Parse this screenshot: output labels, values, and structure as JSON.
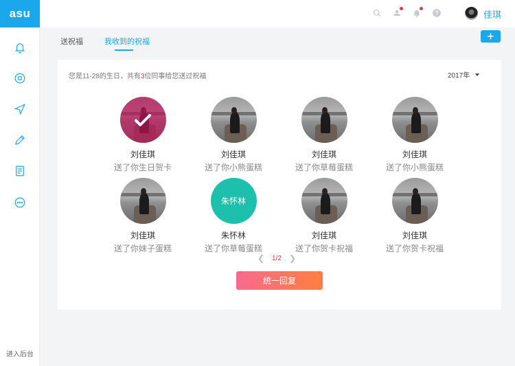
{
  "app": {
    "logo_text": "asu"
  },
  "sidebar": {
    "items": [
      {
        "icon": "bell-icon"
      },
      {
        "icon": "app-circle-icon"
      },
      {
        "icon": "send-icon"
      },
      {
        "icon": "edit-icon"
      },
      {
        "icon": "document-icon"
      },
      {
        "icon": "more-icon"
      }
    ],
    "enter_admin": "进入后台"
  },
  "topbar": {
    "icons": [
      "search-icon",
      "notification-icon",
      "bell-icon",
      "help-icon"
    ],
    "user_name": "佳琪"
  },
  "tabs": {
    "send": "送祝福",
    "received": "我收到的祝福",
    "plus": "+"
  },
  "summary": {
    "prefix": "您是11-28的生日，共有",
    "count": "3",
    "suffix": "位同事给您送过祝福"
  },
  "year": {
    "selected": "2017年"
  },
  "wishes": [
    {
      "name": "刘佳琪",
      "gift": "送了你生日贺卡",
      "avatar": "photo",
      "checked": true
    },
    {
      "name": "刘佳琪",
      "gift": "送了你小熊蛋糕",
      "avatar": "photo",
      "checked": false
    },
    {
      "name": "刘佳琪",
      "gift": "送了你草莓蛋糕",
      "avatar": "photo",
      "checked": false
    },
    {
      "name": "刘佳琪",
      "gift": "送了你小熊蛋糕",
      "avatar": "photo",
      "checked": false
    },
    {
      "name": "刘佳琪",
      "gift": "送了你妹子蛋糕",
      "avatar": "photo",
      "checked": false
    },
    {
      "name": "朱怀林",
      "gift": "送了你草莓蛋糕",
      "avatar": "text",
      "avatar_text": "朱怀林",
      "checked": false
    },
    {
      "name": "刘佳琪",
      "gift": "送了你贺卡祝福",
      "avatar": "photo",
      "checked": false
    },
    {
      "name": "刘佳琪",
      "gift": "送了你贺卡祝福",
      "avatar": "photo",
      "checked": false
    }
  ],
  "pager": {
    "current": "1/2"
  },
  "reply_button": "统一回复",
  "colors": {
    "brand": "#1aa7ec",
    "alert": "#e8383d",
    "text_avatar": "#1dc0ad",
    "reply_start": "#f76a8e",
    "reply_end": "#ff7f3f"
  }
}
